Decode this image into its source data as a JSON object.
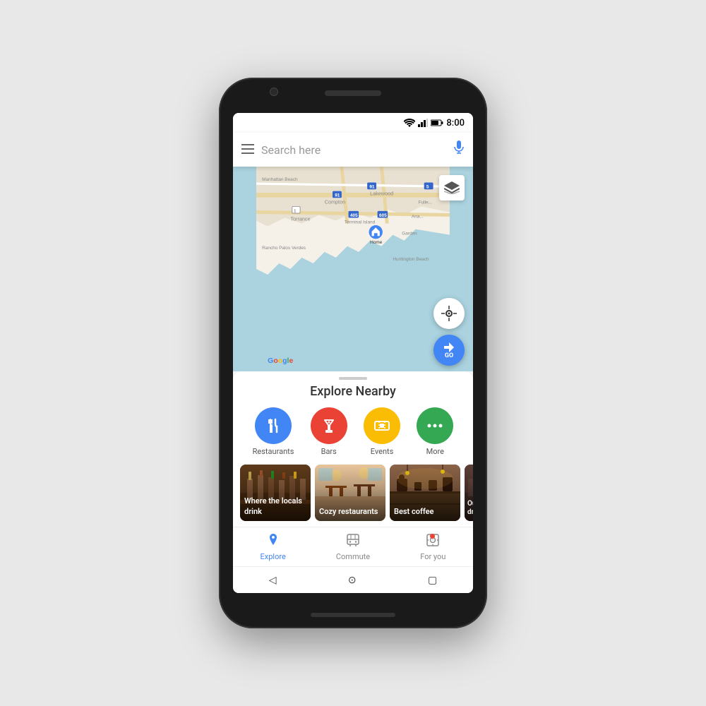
{
  "phone": {
    "status_bar": {
      "time": "8:00"
    },
    "search_bar": {
      "placeholder": "Search here"
    },
    "map": {
      "home_label": "Home",
      "google_label": "Google",
      "layer_icon": "layers",
      "location_icon": "◎",
      "go_label": "GO"
    },
    "explore": {
      "title": "Explore Nearby",
      "drag_handle": "",
      "categories": [
        {
          "label": "Restaurants",
          "color": "#4285f4",
          "icon": "🍴"
        },
        {
          "label": "Bars",
          "color": "#ea4335",
          "icon": "🍸"
        },
        {
          "label": "Events",
          "color": "#fbbc04",
          "icon": "🎟"
        },
        {
          "label": "More",
          "color": "#34a853",
          "icon": "···"
        }
      ],
      "cards": [
        {
          "label": "Where the locals drink",
          "bg_color": "#5d4037"
        },
        {
          "label": "Cozy restaurants",
          "bg_color": "#6d4c41"
        },
        {
          "label": "Best coffee",
          "bg_color": "#4e342e"
        },
        {
          "label": "Ou... dr...",
          "bg_color": "#3e2723"
        }
      ]
    },
    "bottom_nav": [
      {
        "label": "Explore",
        "icon": "📍",
        "active": true
      },
      {
        "label": "Commute",
        "icon": "🏠",
        "active": false
      },
      {
        "label": "For you",
        "icon": "⊕",
        "active": false,
        "has_dot": true
      }
    ],
    "android_nav": {
      "back": "◁",
      "home": "⊙",
      "recents": "▢"
    }
  }
}
